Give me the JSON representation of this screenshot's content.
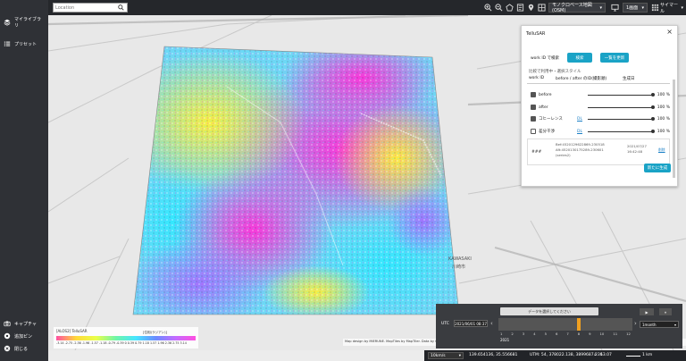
{
  "sidebar": {
    "items": [
      {
        "label": "マイライブラリ",
        "icon": "layers-icon"
      },
      {
        "label": "プリセット",
        "icon": "list-icon"
      }
    ],
    "bottom_items": [
      {
        "label": "キャプチャ",
        "icon": "camera-icon"
      },
      {
        "label": "追加ピン",
        "icon": "pin-icon"
      },
      {
        "label": "閉じる",
        "icon": "close-circle-icon"
      }
    ]
  },
  "topbar": {
    "search_placeholder": "Location",
    "basemap": "モノクロベース地図(OSM)",
    "view_mode": "1画面",
    "user_menu": "サイマール"
  },
  "panel": {
    "title": "TelluSAR",
    "work_label": "work ID で検索",
    "search_button": "検索",
    "list_update_button": "一覧を更新",
    "section_title": "比較で利用中・選択スタイル",
    "col_work_id": "work ID",
    "col_before_after": "before / after のID(撮影順)",
    "col_created": "生成日",
    "layers": [
      {
        "name": "before",
        "value": "100 %",
        "link": ""
      },
      {
        "name": "after",
        "value": "100 %",
        "link": ""
      },
      {
        "name": "コヒーレンス",
        "value": "100 %",
        "link": "DL"
      },
      {
        "name": "差分干渉",
        "value": "100 %",
        "link": "DL"
      }
    ],
    "result": {
      "id": "###",
      "before_id": "Bef:4520129622869-230518",
      "after_id": "Aft:4520130175289-230601",
      "series": "(series2)",
      "date": "2021/07/27",
      "time": "16:42:48",
      "link": "削除"
    },
    "generate_button": "新たに生成"
  },
  "timeline": {
    "utc_label": "UTC",
    "datetime": "2021/06/01 08:37",
    "tooltip": "データを選択してください",
    "year": "2021",
    "month_labels": [
      "1",
      "2",
      "3",
      "4",
      "5",
      "6",
      "7",
      "8",
      "9",
      "10",
      "11",
      "12"
    ],
    "play_label": "▶",
    "step_label": "1month"
  },
  "bottombar": {
    "scale_mode": "10km/s",
    "lonlat": "139.654136, 35.556681",
    "utm": "UTM: 54, 378022.138, 3899687.236",
    "zoom": "13.07",
    "scale": "1 km"
  },
  "legend": {
    "title": "[ALOS2] TelluSAR",
    "unit": "[位相(ラジアン)]",
    "ticks": "-3.14 -2.75 -2.36 -1.96 -1.57 -1.18 -0.79 -0.39 0 0.39 0.79 1.18 1.57 1.96 2.36 2.75 3.14"
  },
  "map": {
    "place_label_1": "KAWASAKI",
    "place_label_2": "川崎市",
    "attribution": "Map design by MIERUNE. MapTiles by MapTiler. Data by OpenStreetMap contributors, under ODbL. ©Tellus. Original data provided by NEC. 衛星画像データ"
  },
  "colors": {
    "sidebar_bg": "#2f3136",
    "topbar_bg": "#25272b",
    "accent": "#1aa3c6",
    "timeline_bg": "#3a3c40",
    "timeline_cursor": "#f0a020"
  }
}
